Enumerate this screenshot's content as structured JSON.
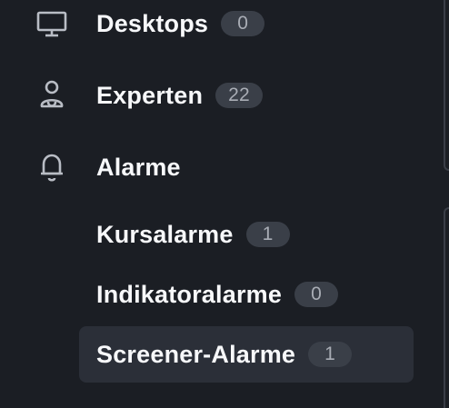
{
  "nav": {
    "desktops": {
      "label": "Desktops",
      "count": "0",
      "icon": "monitor-icon"
    },
    "experten": {
      "label": "Experten",
      "count": "22",
      "icon": "experts-icon"
    },
    "alarme": {
      "label": "Alarme",
      "icon": "bell-icon",
      "children": [
        {
          "label": "Kursalarme",
          "count": "1"
        },
        {
          "label": "Indikatoralarme",
          "count": "0"
        },
        {
          "label": "Screener-Alarme",
          "count": "1",
          "active": true
        }
      ]
    }
  },
  "colors": {
    "background": "#1b1e24",
    "active_background": "#2b2f38",
    "badge_background": "#3a3f48",
    "badge_text": "#a9adb5",
    "text": "#f7f8fa",
    "icon": "#b9bdc5"
  }
}
